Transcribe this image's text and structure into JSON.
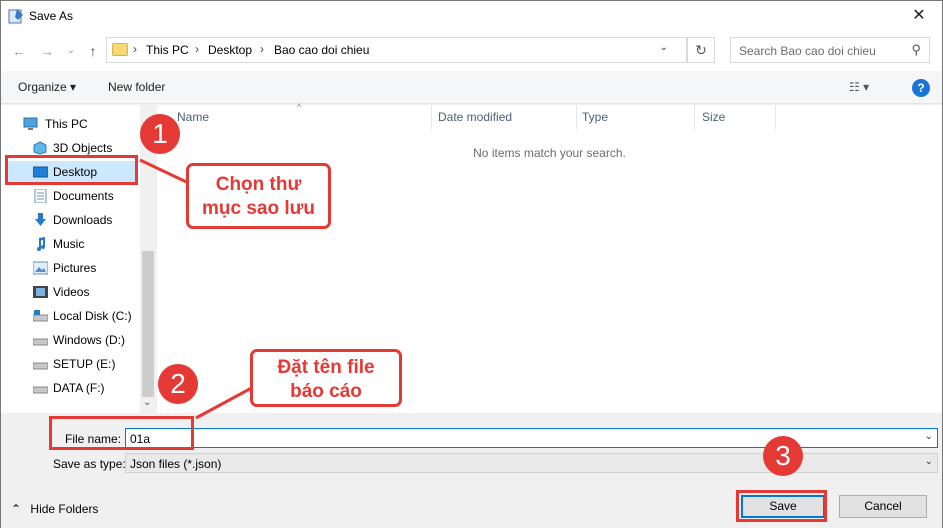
{
  "window": {
    "title": "Save As",
    "close_glyph": "✕"
  },
  "nav": {
    "back_glyph": "←",
    "forward_glyph": "→",
    "recent_glyph": "⌄",
    "up_glyph": "↑",
    "breadcrumbs": [
      "This PC",
      "Desktop",
      "Bao cao doi chieu"
    ],
    "separator": "›",
    "refresh_glyph": "↻",
    "search_placeholder": "Search Bao cao doi chieu",
    "search_glyph": "⚲"
  },
  "toolbar": {
    "organize_label": "Organize ▾",
    "new_folder_label": "New folder",
    "view_glyph": "☷ ▾",
    "help_glyph": "?"
  },
  "sidebar": {
    "items": [
      {
        "label": "This PC",
        "icon": "pc-icon"
      },
      {
        "label": "3D Objects",
        "icon": "cube-icon"
      },
      {
        "label": "Desktop",
        "icon": "desktop-icon"
      },
      {
        "label": "Documents",
        "icon": "document-icon"
      },
      {
        "label": "Downloads",
        "icon": "download-icon"
      },
      {
        "label": "Music",
        "icon": "music-icon"
      },
      {
        "label": "Pictures",
        "icon": "pictures-icon"
      },
      {
        "label": "Videos",
        "icon": "video-icon"
      },
      {
        "label": "Local Disk (C:)",
        "icon": "drive-icon"
      },
      {
        "label": "Windows (D:)",
        "icon": "drive-icon"
      },
      {
        "label": "SETUP (E:)",
        "icon": "drive-icon"
      },
      {
        "label": "DATA (F:)",
        "icon": "drive-icon"
      }
    ],
    "selected_index": 2,
    "scroll_down_glyph": "⌄"
  },
  "filelist": {
    "columns": [
      "Name",
      "Date modified",
      "Type",
      "Size"
    ],
    "sort_glyph": "^",
    "empty_message": "No items match your search."
  },
  "form": {
    "file_name_label": "File name:",
    "file_name_value": "01a",
    "save_type_label": "Save as type:",
    "save_type_value": "Json files (*.json)",
    "drop_glyph": "⌄"
  },
  "footer": {
    "hide_folders_label": "Hide Folders",
    "hide_glyph": "⌃",
    "save_label": "Save",
    "cancel_label": "Cancel"
  },
  "annotations": {
    "step1": "1",
    "step2": "2",
    "step3": "3",
    "callout1_line1": "Chọn thư",
    "callout1_line2": "mục sao lưu",
    "callout2_line1": "Đặt tên file",
    "callout2_line2": "báo cáo",
    "color": "#e53935"
  },
  "colors": {
    "accent": "#0078d7",
    "selection": "#cce8ff",
    "help": "#1874d6"
  }
}
